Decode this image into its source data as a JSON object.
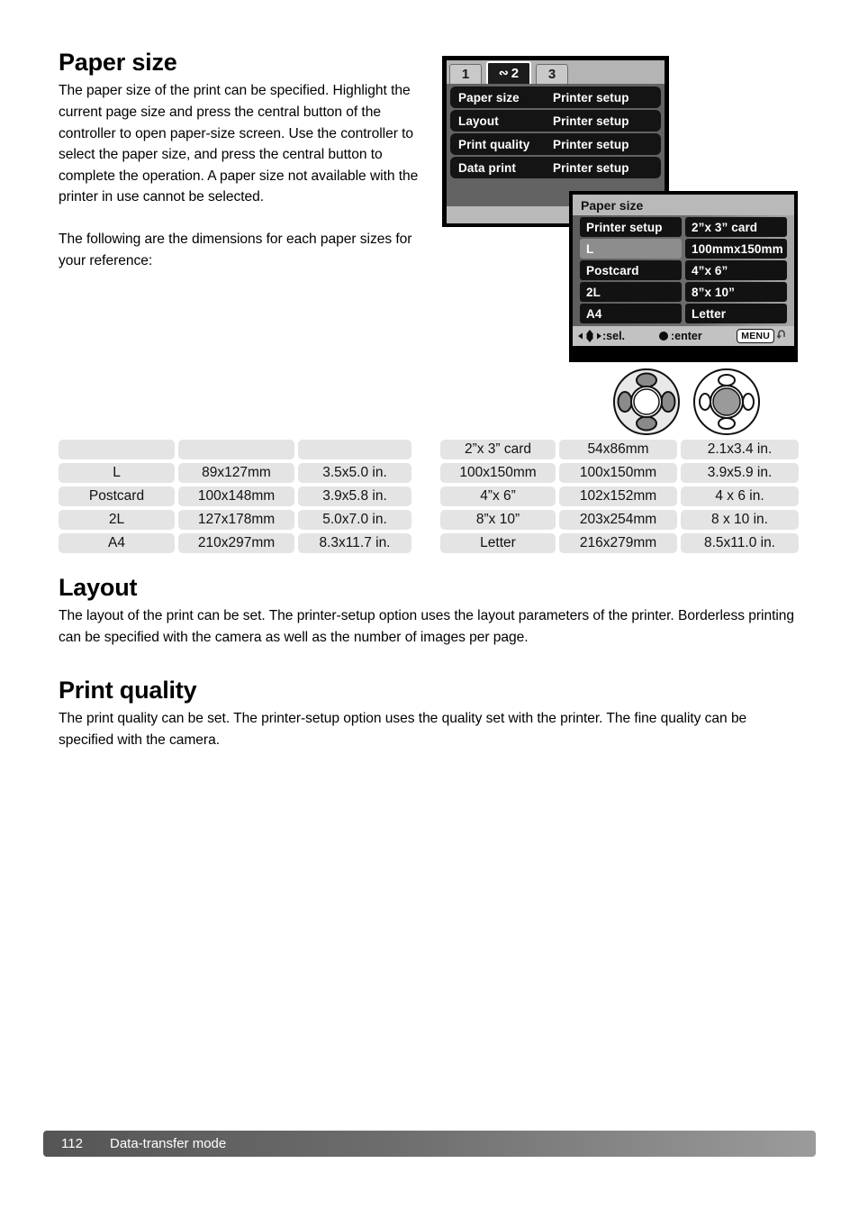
{
  "page": {
    "number": "112",
    "footer_title": "Data-transfer mode"
  },
  "sections": {
    "paper_size": {
      "title": "Paper size",
      "paragraph1": "The paper size of the print can be specified. Highlight the current page size and press the central button of the controller to open paper-size screen. Use the controller to select the paper size, and press the central button to complete the operation. A paper size not available with the printer in use cannot be selected.",
      "paragraph2": "The following are the dimensions for each paper sizes for your reference:"
    },
    "layout": {
      "title": "Layout",
      "paragraph": "The layout of the print can be set. The printer-setup option uses the layout parameters of the printer. Borderless printing can be specified with the camera as well as the number of images per page."
    },
    "print_quality": {
      "title": "Print quality",
      "paragraph": "The print quality can be set. The printer-setup option uses the quality set with the printer. The fine quality can be specified with the camera."
    }
  },
  "menu_screen": {
    "tabs": [
      {
        "label": "1",
        "active": false
      },
      {
        "label": "2",
        "active": true,
        "icon": "wave-icon"
      },
      {
        "label": "3",
        "active": false
      }
    ],
    "rows": [
      {
        "label": "Paper size",
        "value": "Printer setup"
      },
      {
        "label": "Layout",
        "value": "Printer setup"
      },
      {
        "label": "Print quality",
        "value": "Printer setup"
      },
      {
        "label": "Data print",
        "value": "Printer setup"
      }
    ]
  },
  "paper_size_dialog": {
    "title": "Paper size",
    "options": [
      {
        "left": "Printer setup",
        "right": "2”x 3” card",
        "selected": false
      },
      {
        "left": "L",
        "right": "100mmx150mm",
        "selected": true
      },
      {
        "left": "Postcard",
        "right": "4”x 6”",
        "selected": false
      },
      {
        "left": "2L",
        "right": "8”x 10”",
        "selected": false
      },
      {
        "left": "A4",
        "right": "Letter",
        "selected": false
      }
    ],
    "bar": {
      "select_label": ":sel.",
      "enter_label": ":enter",
      "menu_label": "MENU"
    }
  },
  "tables": {
    "left": {
      "header": [
        "",
        "",
        ""
      ],
      "rows": [
        [
          "L",
          "89x127mm",
          "3.5x5.0 in."
        ],
        [
          "Postcard",
          "100x148mm",
          "3.9x5.8 in."
        ],
        [
          "2L",
          "127x178mm",
          "5.0x7.0 in."
        ],
        [
          "A4",
          "210x297mm",
          "8.3x11.7 in."
        ]
      ]
    },
    "right": {
      "rows": [
        [
          "2”x 3” card",
          "54x86mm",
          "2.1x3.4 in."
        ],
        [
          "100x150mm",
          "100x150mm",
          "3.9x5.9 in."
        ],
        [
          "4”x 6”",
          "102x152mm",
          "4 x 6 in."
        ],
        [
          "8”x 10”",
          "203x254mm",
          "8 x 10 in."
        ],
        [
          "Letter",
          "216x279mm",
          "8.5x11.0 in."
        ]
      ]
    }
  },
  "colors": {
    "cell_bg": "#e4e4e4",
    "menu_row_bg": "#141414",
    "selected_bg": "#8d8d8d",
    "footer_dark": "#555555",
    "footer_light": "#9b9b9b"
  }
}
